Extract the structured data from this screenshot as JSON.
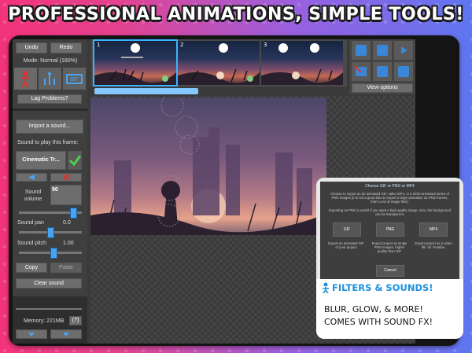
{
  "headline": "PROFESSIONAL ANIMATIONS, SIMPLE TOOLS!",
  "left_panel": {
    "undo": "Undo",
    "redo": "Redo",
    "mode": "Mode: Normal (180%)",
    "lag": "Lag Problems?",
    "import_sound": "Import a sound...",
    "sound_label": "Sound to play this frame:",
    "sound_name": "Cinematic Tr...",
    "volume_label": "Sound volume",
    "volume_value": "90",
    "pan_label": "Sound pan",
    "pan_value": "0.0",
    "pitch_label": "Sound pitch",
    "pitch_value": "1.00",
    "copy": "Copy",
    "paste": "Paste",
    "clear_sound": "Clear sound",
    "memory": "Memory: 221MB",
    "help": "(?)",
    "volume_level": 0.9,
    "pan_level": 0.5,
    "pitch_level": 0.55
  },
  "frames": [
    "1",
    "2",
    "3"
  ],
  "right_panel": {
    "view_options": "View options"
  },
  "export_dialog": {
    "title": "Choose GIF or PNG or MP4",
    "desc1": "Choose to export as an animated GIF, video MP4, or a NON-animated series of PNG images (it is not a good idea to export a large animation as PNG frames, that's a lot of image files).",
    "desc2": "Exporting as PNG is useful if you want a high quality image. Also, the background can be transparent.",
    "gif": "GIF",
    "png": "PNG",
    "mp4": "MP4",
    "gif_desc": "Export an animated GIF of your project",
    "png_desc": "Export project as single PNG images, higher quality than GIF",
    "mp4_desc": "Export project as a video file, for Youtube.",
    "cancel": "Cancel"
  },
  "promo": {
    "heading": "FILTERS & SOUNDS!",
    "line1": "BLUR, GLOW, & MORE!",
    "line2": "COMES WITH SOUND FX!"
  },
  "colors": {
    "accent": "#3db2ff",
    "promo_blue": "#1e90dc",
    "button_grey": "#6d6d6d"
  }
}
